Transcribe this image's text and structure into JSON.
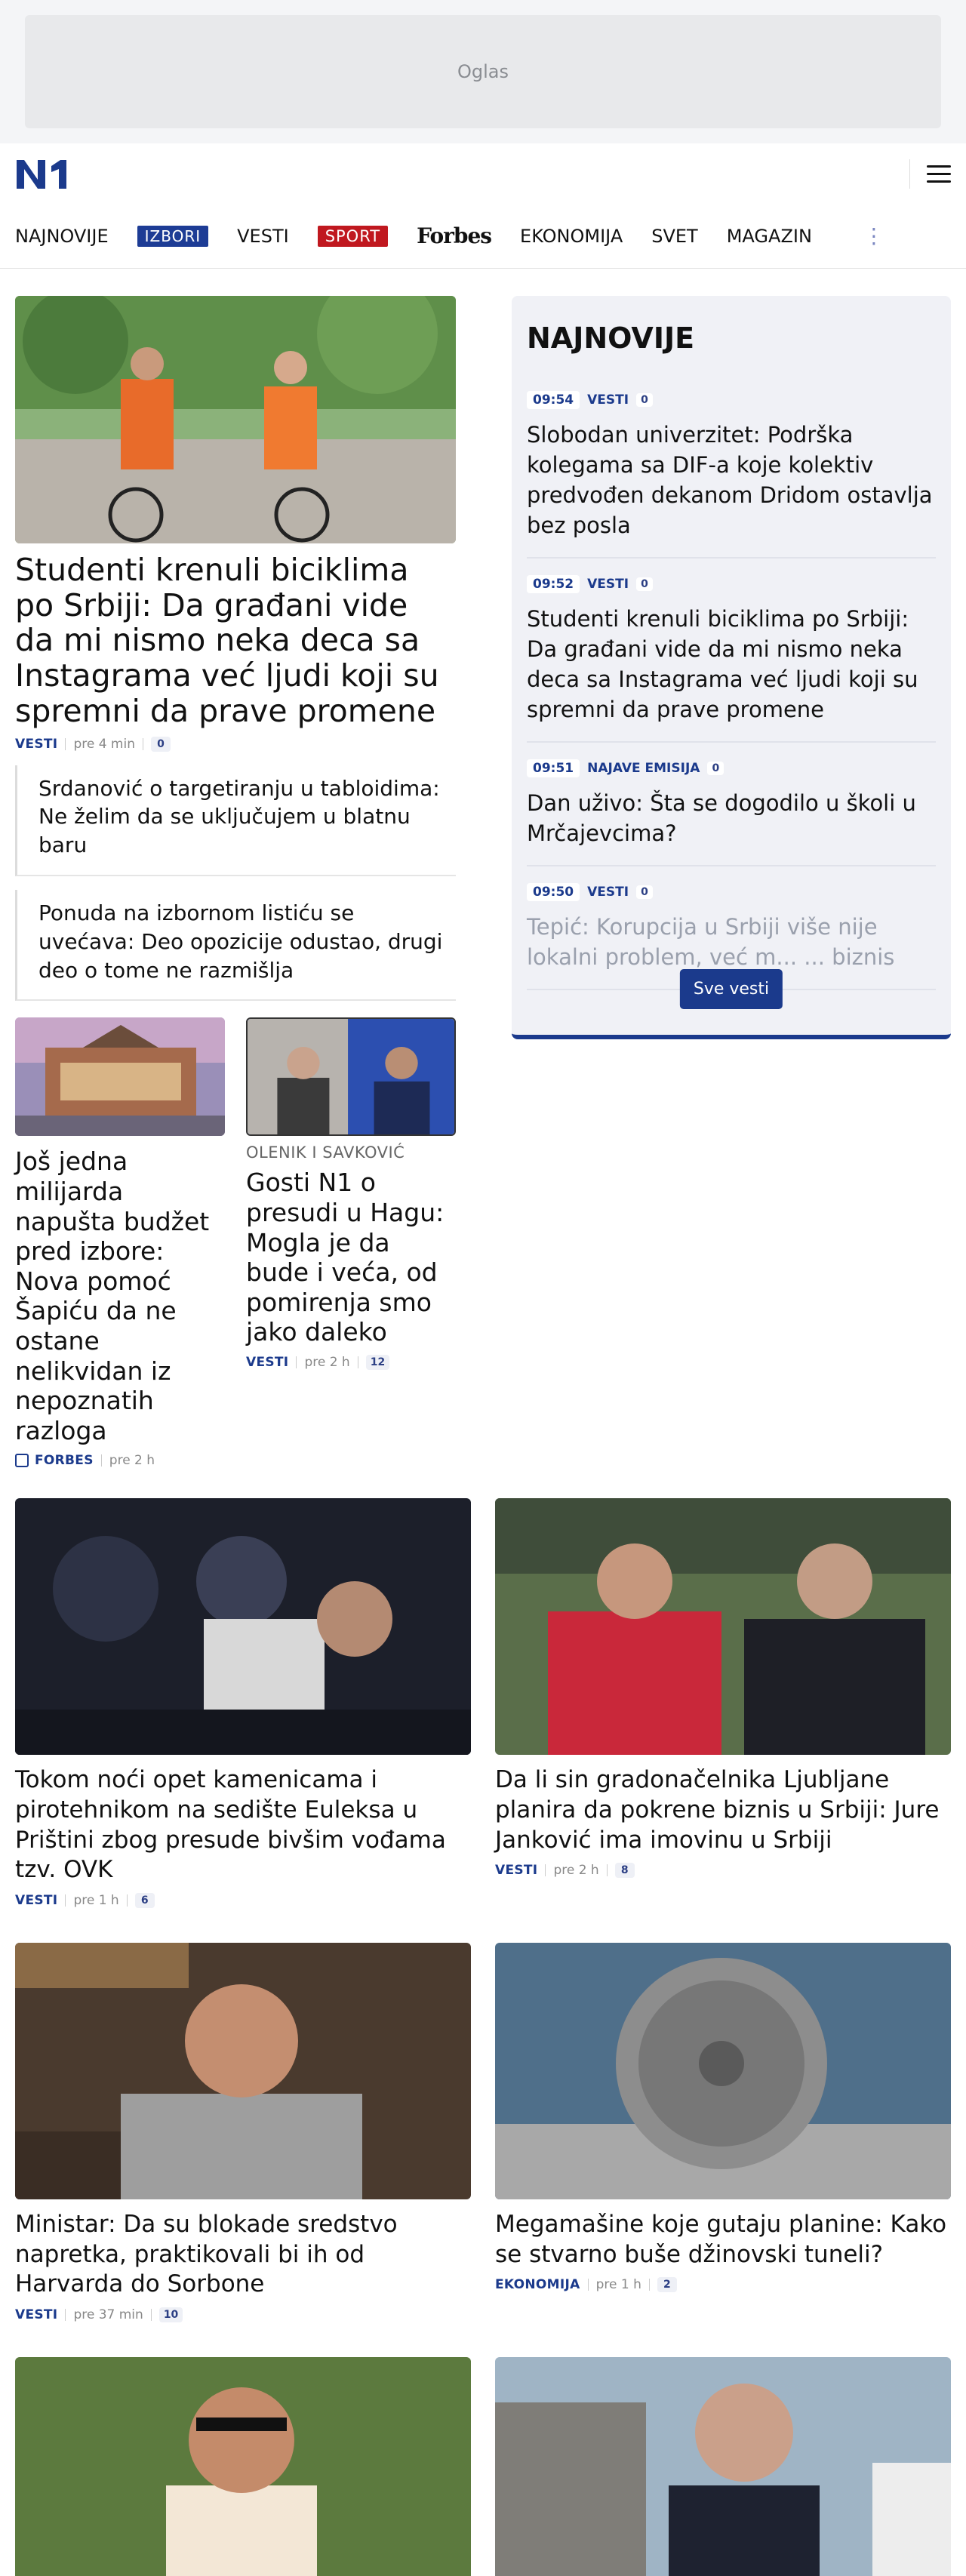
{
  "ad": {
    "label": "Oglas"
  },
  "header": {
    "logo": "N1"
  },
  "nav": {
    "items": [
      "NAJNOVIJE",
      "IZBORI",
      "VESTI",
      "SPORT",
      "Forbes",
      "EKONOMIJA",
      "SVET",
      "MAGAZIN"
    ],
    "more": "⋮"
  },
  "lead": {
    "title": "Studenti krenuli biciklima po Srbiji: Da građani vide da mi nismo neka deca sa Instagrama već ljudi koji su spremni da prave promene",
    "category": "VESTI",
    "time": "pre 4 min",
    "comments": "0"
  },
  "related": [
    "Srdanović o targetiranju u tabloidima: Ne želim da se uključujem u blatnu baru",
    "Ponuda na izbornom listiću se uvećava: Deo opozicije odustao, drugi deo o tome ne razmišlja"
  ],
  "latest": {
    "title": "NAJNOVIJE",
    "items": [
      {
        "time": "09:54",
        "category": "VESTI",
        "comments": "0",
        "text": "Slobodan univerzitet: Podrška kolegama sa DIF-a koje kolektiv predvođen dekanom Dridom ostavlja bez posla"
      },
      {
        "time": "09:52",
        "category": "VESTI",
        "comments": "0",
        "text": "Studenti krenuli biciklima po Srbiji: Da građani vide da mi nismo neka deca sa Instagrama već ljudi koji su spremni da prave promene"
      },
      {
        "time": "09:51",
        "category": "NAJAVE EMISIJA",
        "comments": "0",
        "text": "Dan uživo: Šta se dogodilo u školi u Mrčajevcima?"
      },
      {
        "time": "09:50",
        "category": "VESTI",
        "comments": "0",
        "text": "Tepić: Korupcija u Srbiji više nije lokalni problem, već m... ... biznis"
      }
    ],
    "button": "Sve vesti"
  },
  "small_cards": [
    {
      "kicker": "",
      "title": "Još jedna milijarda napušta budžet pred izbore: Nova pomoć Šapiću da ne ostane nelikvidan iz nepoznatih razloga",
      "category": "FORBES",
      "time": "pre 2 h",
      "comments": ""
    },
    {
      "kicker": "OLENIK I SAVKOVIĆ",
      "title": "Gosti N1 o presudi u Hagu: Mogla je da bude i veća, od pomirenja smo jako daleko",
      "category": "VESTI",
      "time": "pre 2 h",
      "comments": "12"
    }
  ],
  "grid_cards": [
    {
      "title": "Tokom noći opet kamenicama i pirotehnikom na sedište Euleksa u Prištini zbog presude bivšim vođama tzv. OVK",
      "category": "VESTI",
      "time": "pre 1 h",
      "comments": "6"
    },
    {
      "title": "Da li sin gradonačelnika Ljubljane planira da pokrene biznis u Srbiji: Jure Janković ima imovinu u Srbiji",
      "category": "VESTI",
      "time": "pre 2 h",
      "comments": "8"
    },
    {
      "title": "Ministar: Da su blokade sredstvo napretka, praktikovali bi ih od Harvarda do Sorbone",
      "category": "VESTI",
      "time": "pre 37 min",
      "comments": "10"
    },
    {
      "title": "Megamašine koje gutaju planine: Kako se stvarno buše džinovski tuneli?",
      "category": "EKONOMIJA",
      "time": "pre 1 h",
      "comments": "2"
    }
  ]
}
